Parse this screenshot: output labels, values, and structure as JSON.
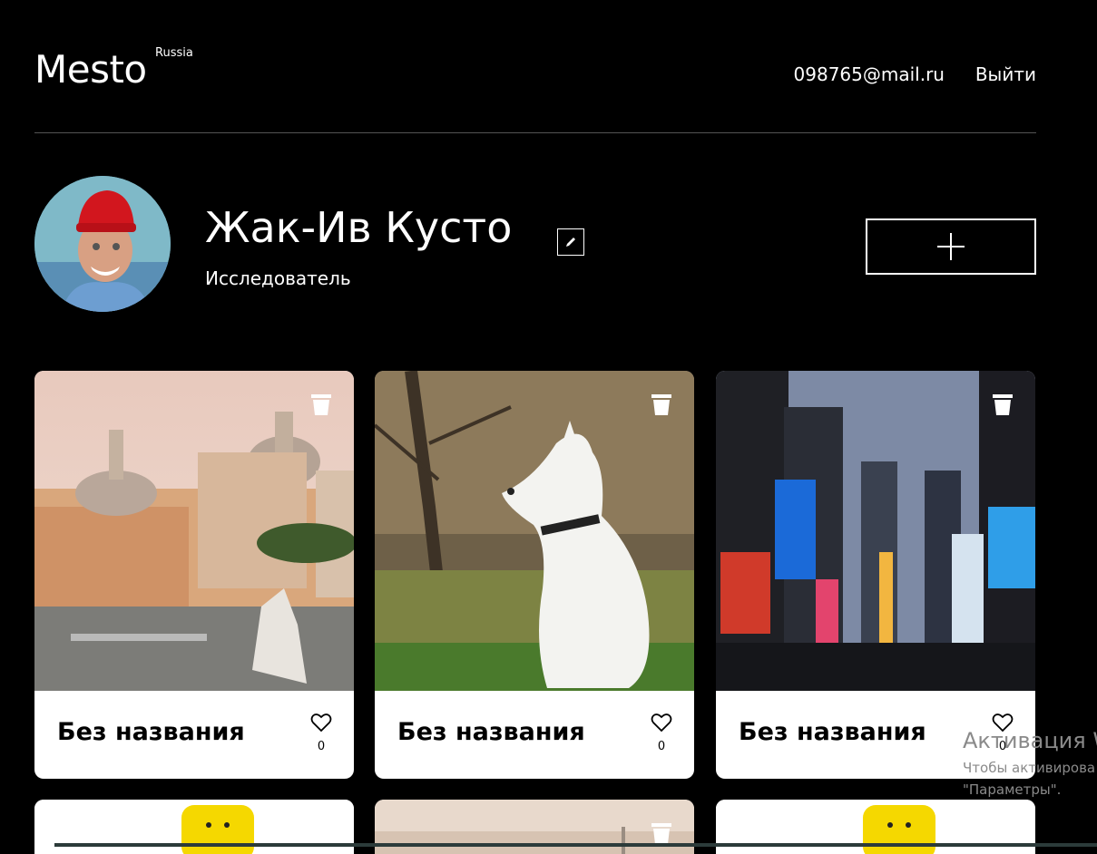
{
  "header": {
    "logo": "Mesto",
    "logo_sup": "Russia",
    "email": "098765@mail.ru",
    "logout": "Выйти"
  },
  "profile": {
    "name": "Жак-Ив Кусто",
    "about": "Исследователь"
  },
  "cards": [
    {
      "title": "Без названия",
      "likes": "0",
      "photo": "rome-city-square"
    },
    {
      "title": "Без названия",
      "likes": "0",
      "photo": "white-husky-dog"
    },
    {
      "title": "Без названия",
      "likes": "0",
      "photo": "times-square-night"
    }
  ],
  "windows_activation": {
    "title": "Активация W",
    "line1": "Чтобы активирова",
    "line2": "\"Параметры\"."
  },
  "icons": {
    "edit": "pencil-icon",
    "add": "plus-icon",
    "like": "heart-icon",
    "delete": "trash-icon"
  }
}
